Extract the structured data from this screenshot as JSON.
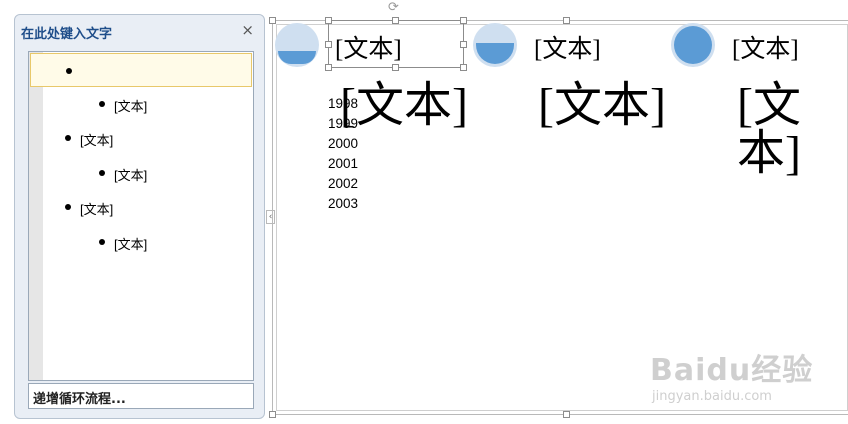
{
  "pane": {
    "title": "在此处键入文字",
    "close_glyph": "×",
    "items": [
      {
        "text": "",
        "level": 1
      },
      {
        "text": "[文本]",
        "level": 2
      },
      {
        "text": "[文本]",
        "level": 1
      },
      {
        "text": "[文本]",
        "level": 2
      },
      {
        "text": "[文本]",
        "level": 1
      },
      {
        "text": "[文本]",
        "level": 2
      }
    ],
    "footer": "递增循环流程..."
  },
  "canvas": {
    "small_labels": [
      "[文本]",
      "[文本]",
      "[文本]"
    ],
    "big_labels": [
      "[文本]",
      "[文本]",
      "[文本]"
    ],
    "years": [
      "1998",
      "1999",
      "2000",
      "2001",
      "2002",
      "2003"
    ],
    "circle_fill_levels": [
      0.35,
      0.55,
      1.0
    ],
    "accent_color": "#5b9bd5"
  },
  "icons": {
    "collapse": "‹",
    "rotate": "⟳"
  },
  "watermark": {
    "logo": "Baidu经验",
    "url": "jingyan.baidu.com"
  }
}
